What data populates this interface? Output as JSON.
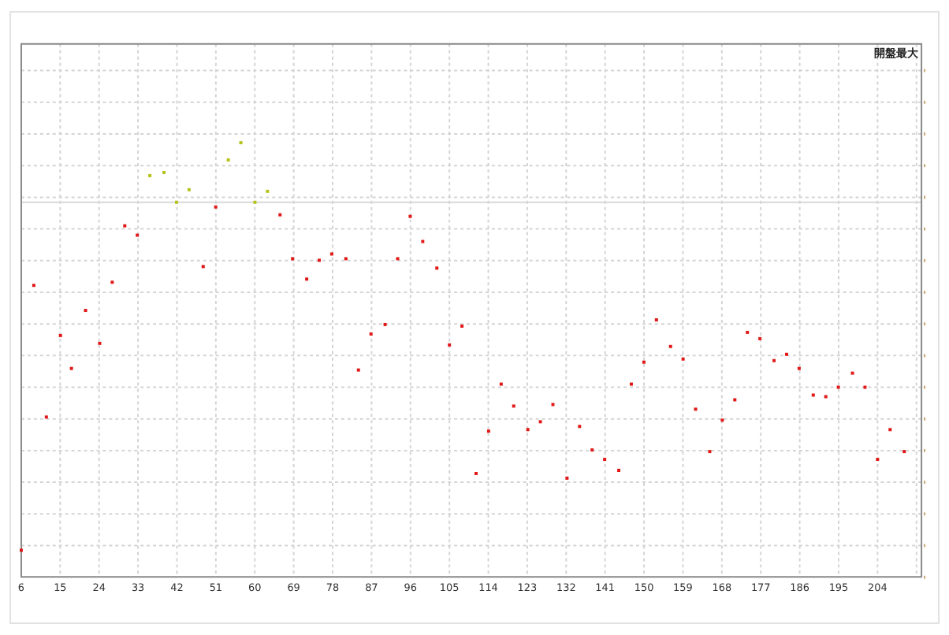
{
  "chart": {
    "legend": "開盤最大",
    "x_axis_labels": [
      "6",
      "15",
      "24",
      "33",
      "42",
      "51",
      "60",
      "69",
      "78",
      "87",
      "96",
      "105",
      "114",
      "123",
      "132",
      "141",
      "150",
      "159",
      "168",
      "177",
      "186",
      "195",
      "204"
    ]
  }
}
